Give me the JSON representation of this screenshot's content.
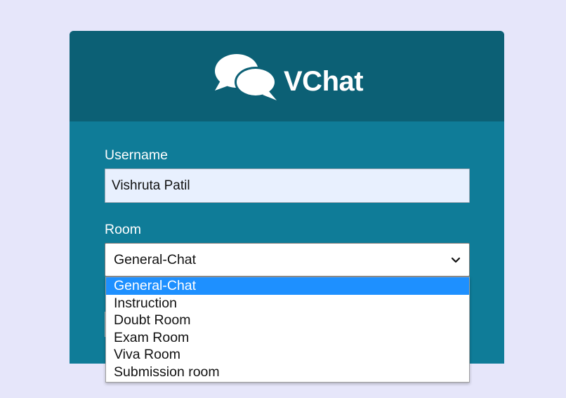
{
  "app": {
    "title": "VChat",
    "header_bg": "#0c6075",
    "body_bg": "#0f7c98",
    "page_bg": "#e6e6fa"
  },
  "form": {
    "username_label": "Username",
    "username_value": "Vishruta Patil",
    "room_label": "Room",
    "room_selected": "General-Chat"
  },
  "room_options": [
    {
      "label": "General-Chat",
      "selected": true
    },
    {
      "label": "Instruction",
      "selected": false
    },
    {
      "label": "Doubt Room",
      "selected": false
    },
    {
      "label": "Exam Room",
      "selected": false
    },
    {
      "label": "Viva Room",
      "selected": false
    },
    {
      "label": "Submission room",
      "selected": false
    }
  ],
  "icons": {
    "logo": "chat-bubbles-icon",
    "select_arrow": "chevron-down-icon"
  },
  "colors": {
    "selected_option_bg": "#1e90ff",
    "input_bg": "#e8f0fe"
  }
}
